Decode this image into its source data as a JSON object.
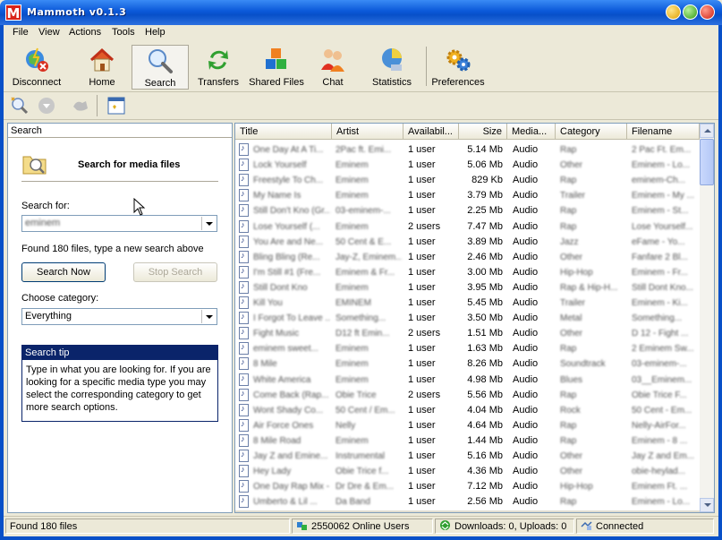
{
  "window": {
    "title": "Mammoth v0.1.3",
    "icon_letter": "M"
  },
  "menu": [
    "File",
    "View",
    "Actions",
    "Tools",
    "Help"
  ],
  "toolbar": [
    {
      "label": "Disconnect",
      "icon": "disconnect-icon"
    },
    {
      "label": "Home",
      "icon": "home-icon"
    },
    {
      "label": "Search",
      "icon": "search-icon",
      "active": true
    },
    {
      "label": "Transfers",
      "icon": "transfers-icon"
    },
    {
      "label": "Shared Files",
      "icon": "shared-files-icon"
    },
    {
      "label": "Chat",
      "icon": "chat-icon"
    },
    {
      "label": "Statistics",
      "icon": "statistics-icon"
    },
    {
      "label": "Preferences",
      "icon": "preferences-icon"
    }
  ],
  "search_panel": {
    "header": "Search",
    "title": "Search for media files",
    "search_for_label": "Search for:",
    "search_value": "eminem",
    "found_message": "Found 180 files, type a new search above",
    "search_now": "Search Now",
    "stop_search": "Stop Search",
    "category_label": "Choose category:",
    "category_value": "Everything",
    "tip_title": "Search tip",
    "tip_text": "Type in what you are looking for. If you are looking for a specific media type you may select the corresponding category to get more search options."
  },
  "columns": [
    "Title",
    "Artist",
    "Availabil...",
    "Size",
    "Media...",
    "Category",
    "Filename"
  ],
  "results": [
    {
      "title": "One Day At A Ti...",
      "artist": "2Pac ft. Emi...",
      "avail": "1 user",
      "size": "5.14 Mb",
      "media": "Audio",
      "category": "Rap",
      "filename": "2 Pac Ft. Em..."
    },
    {
      "title": "Lock Yourself",
      "artist": "Eminem",
      "avail": "1 user",
      "size": "5.06 Mb",
      "media": "Audio",
      "category": "Other",
      "filename": "Eminem - Lo..."
    },
    {
      "title": "Freestyle To Ch...",
      "artist": "Eminem",
      "avail": "1 user",
      "size": "829 Kb",
      "media": "Audio",
      "category": "Rap",
      "filename": "eminem-Ch..."
    },
    {
      "title": "My Name Is",
      "artist": "Eminem",
      "avail": "1 user",
      "size": "3.79 Mb",
      "media": "Audio",
      "category": "Trailer",
      "filename": "Eminem - My ..."
    },
    {
      "title": "Still Don't Kno (Gr...",
      "artist": "03-eminem-...",
      "avail": "1 user",
      "size": "2.25 Mb",
      "media": "Audio",
      "category": "Rap",
      "filename": "Eminem - St..."
    },
    {
      "title": "Lose Yourself (...",
      "artist": "Eminem",
      "avail": "2 users",
      "size": "7.47 Mb",
      "media": "Audio",
      "category": "Rap",
      "filename": "Lose Yourself..."
    },
    {
      "title": "You Are and Ne...",
      "artist": "50 Cent & E...",
      "avail": "1 user",
      "size": "3.89 Mb",
      "media": "Audio",
      "category": "Jazz",
      "filename": "eFame - Yo..."
    },
    {
      "title": "Bling Bling (Re...",
      "artist": "Jay-Z, Eminem...",
      "avail": "1 user",
      "size": "2.46 Mb",
      "media": "Audio",
      "category": "Other",
      "filename": "Fanfare 2 Bl..."
    },
    {
      "title": "I'm Still #1 (Fre...",
      "artist": "Eminem & Fr...",
      "avail": "1 user",
      "size": "3.00 Mb",
      "media": "Audio",
      "category": "Hip-Hop",
      "filename": "Eminem - Fr..."
    },
    {
      "title": "Still Dont Kno",
      "artist": "Eminem",
      "avail": "1 user",
      "size": "3.95 Mb",
      "media": "Audio",
      "category": "Rap & Hip-H...",
      "filename": "Still Dont Kno..."
    },
    {
      "title": "Kill You",
      "artist": "EMINEM",
      "avail": "1 user",
      "size": "5.45 Mb",
      "media": "Audio",
      "category": "Trailer",
      "filename": "Eminem - Ki..."
    },
    {
      "title": "I Forgot To Leave ...",
      "artist": "Something...",
      "avail": "1 user",
      "size": "3.50 Mb",
      "media": "Audio",
      "category": "Metal",
      "filename": "Something..."
    },
    {
      "title": "Fight Music",
      "artist": "D12 ft Emin...",
      "avail": "2 users",
      "size": "1.51 Mb",
      "media": "Audio",
      "category": "Other",
      "filename": "D 12 - Fight ..."
    },
    {
      "title": "eminem sweet...",
      "artist": "Eminem",
      "avail": "1 user",
      "size": "1.63 Mb",
      "media": "Audio",
      "category": "Rap",
      "filename": "2 Eminem Sw..."
    },
    {
      "title": "8 Mile",
      "artist": "Eminem",
      "avail": "1 user",
      "size": "8.26 Mb",
      "media": "Audio",
      "category": "Soundtrack",
      "filename": "03-eminem-..."
    },
    {
      "title": "White America",
      "artist": "Eminem",
      "avail": "1 user",
      "size": "4.98 Mb",
      "media": "Audio",
      "category": "Blues",
      "filename": "03__Eminem..."
    },
    {
      "title": "Come Back (Rap...",
      "artist": "Obie Trice",
      "avail": "2 users",
      "size": "5.56 Mb",
      "media": "Audio",
      "category": "Rap",
      "filename": "Obie Trice F..."
    },
    {
      "title": "Wont Shady Co...",
      "artist": "50 Cent / Em...",
      "avail": "1 user",
      "size": "4.04 Mb",
      "media": "Audio",
      "category": "Rock",
      "filename": "50 Cent - Em..."
    },
    {
      "title": "Air Force Ones",
      "artist": "Nelly",
      "avail": "1 user",
      "size": "4.64 Mb",
      "media": "Audio",
      "category": "Rap",
      "filename": "Nelly-AirFor..."
    },
    {
      "title": "8 Mile Road",
      "artist": "Eminem",
      "avail": "1 user",
      "size": "1.44 Mb",
      "media": "Audio",
      "category": "Rap",
      "filename": "Eminem - 8 ..."
    },
    {
      "title": "Jay Z and Emine...",
      "artist": "Instrumental",
      "avail": "1 user",
      "size": "5.16 Mb",
      "media": "Audio",
      "category": "Other",
      "filename": "Jay Z and Em..."
    },
    {
      "title": "Hey Lady",
      "artist": "Obie Trice f...",
      "avail": "1 user",
      "size": "4.36 Mb",
      "media": "Audio",
      "category": "Other",
      "filename": "obie-heylad..."
    },
    {
      "title": "One Day Rap Mix - E...",
      "artist": "Dr Dre & Em...",
      "avail": "1 user",
      "size": "7.12 Mb",
      "media": "Audio",
      "category": "Hip-Hop",
      "filename": "Eminem Ft. ..."
    },
    {
      "title": "Umberto & Lil ...",
      "artist": "Da Band",
      "avail": "1 user",
      "size": "2.56 Mb",
      "media": "Audio",
      "category": "Rap",
      "filename": "Eminem - Lo..."
    }
  ],
  "status": {
    "left": "Found 180 files",
    "online": "2550062 Online Users",
    "transfers": "Downloads: 0, Uploads: 0",
    "connection": "Connected"
  }
}
